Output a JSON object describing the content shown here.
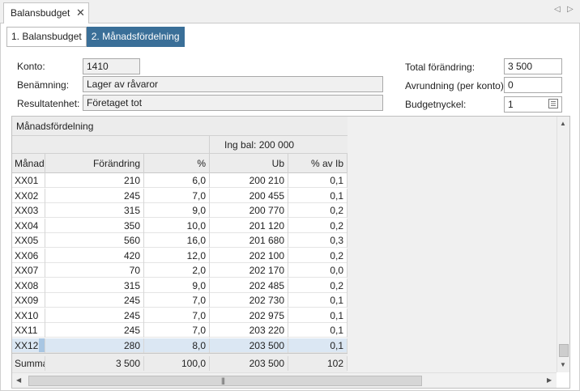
{
  "tab": {
    "title": "Balansbudget",
    "close": "✕"
  },
  "nav": {
    "prev": "◁",
    "next": "▷"
  },
  "steps": {
    "step1": "1. Balansbudget",
    "step2": "2. Månadsfördelning"
  },
  "form": {
    "konto_label": "Konto:",
    "konto_value": "1410",
    "benamning_label": "Benämning:",
    "benamning_value": "Lager av råvaror",
    "resultatenhet_label": "Resultatenhet:",
    "resultatenhet_value": "Företaget tot",
    "total_label": "Total förändring:",
    "total_value": "3 500",
    "avrundning_label": "Avrundning (per konto):",
    "avrundning_value": "0",
    "budgetnyckel_label": "Budgetnyckel:",
    "budgetnyckel_value": "1"
  },
  "grid": {
    "group_title": "Månadsfördelning",
    "band_label": "Ing bal: 200 000",
    "columns": [
      "Månad",
      "Förändring",
      "%",
      "Ub",
      "% av Ib"
    ],
    "rows": [
      [
        "XX01",
        "210",
        "6,0",
        "200 210",
        "0,1"
      ],
      [
        "XX02",
        "245",
        "7,0",
        "200 455",
        "0,1"
      ],
      [
        "XX03",
        "315",
        "9,0",
        "200 770",
        "0,2"
      ],
      [
        "XX04",
        "350",
        "10,0",
        "201 120",
        "0,2"
      ],
      [
        "XX05",
        "560",
        "16,0",
        "201 680",
        "0,3"
      ],
      [
        "XX06",
        "420",
        "12,0",
        "202 100",
        "0,2"
      ],
      [
        "XX07",
        "70",
        "2,0",
        "202 170",
        "0,0"
      ],
      [
        "XX08",
        "315",
        "9,0",
        "202 485",
        "0,2"
      ],
      [
        "XX09",
        "245",
        "7,0",
        "202 730",
        "0,1"
      ],
      [
        "XX10",
        "245",
        "7,0",
        "202 975",
        "0,1"
      ],
      [
        "XX11",
        "245",
        "7,0",
        "203 220",
        "0,1"
      ],
      [
        "XX12",
        "280",
        "8,0",
        "203 500",
        "0,1"
      ]
    ],
    "selected_row": 11,
    "summary": [
      "Summa",
      "3 500",
      "100,0",
      "203 500",
      "102"
    ]
  },
  "colors": {
    "accent": "#3a6f98",
    "selection": "#dbe7f3",
    "header_bg": "#ececec"
  },
  "icons": {
    "close": "close-icon",
    "prev": "arrow-left-icon",
    "next": "arrow-right-icon",
    "lookup": "list-lookup-icon"
  }
}
